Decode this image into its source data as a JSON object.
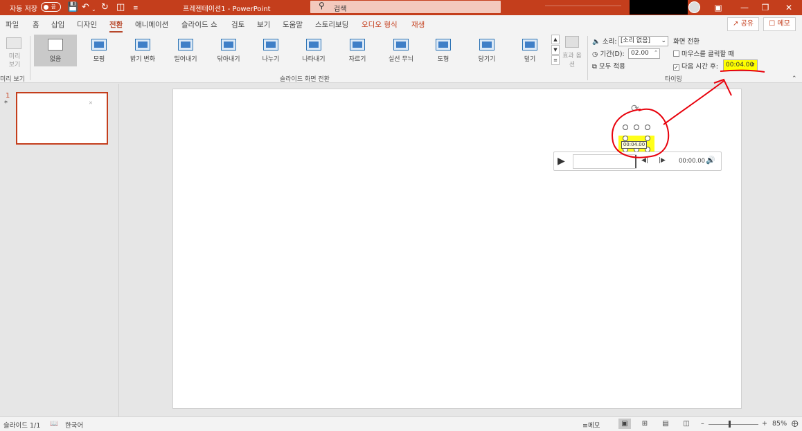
{
  "titlebar": {
    "autosave_label": "자동 저장",
    "autosave_state": "끔",
    "document_title": "프레젠테이션1  -  PowerPoint",
    "search_placeholder": "검색"
  },
  "menu": {
    "tabs": [
      "파일",
      "홈",
      "삽입",
      "디자인",
      "전환",
      "애니메이션",
      "슬라이드 쇼",
      "검토",
      "보기",
      "도움말",
      "스토리보딩",
      "오디오 형식",
      "재생"
    ],
    "active_tab": "전환",
    "share_label": "공유",
    "memo_label": "메모"
  },
  "ribbon": {
    "preview_label": "미리 보기",
    "preview_group_label": "미리 보기",
    "transitions": [
      "없음",
      "모핑",
      "밝기 변화",
      "밀어내기",
      "닦아내기",
      "나누기",
      "나타내기",
      "자르기",
      "실선 무늬",
      "도형",
      "당기기",
      "덮기"
    ],
    "selected_transition": "없음",
    "effect_options_label": "효과 옵션",
    "transitions_group_label": "슬라이드 화면 전환",
    "sound_label": "소리:",
    "sound_value": "[소리 없음]",
    "duration_label": "기간(D):",
    "duration_value": "02.00",
    "apply_all_label": "모두 적용",
    "advance_label": "화면 전환",
    "on_click_label": "마우스를 클릭할 때",
    "on_click_checked": false,
    "after_label": "다음 시간 후:",
    "after_checked": true,
    "after_value": "00:04.00",
    "timing_group_label": "타이밍"
  },
  "slides_panel": {
    "slide_number": "1",
    "slide_marker": "*"
  },
  "audio_player": {
    "time": "00:00.00",
    "trigger_tag": "00:04.00"
  },
  "statusbar": {
    "slide_info": "슬라이드 1/1",
    "language": "한국어",
    "notes_label": "메모",
    "zoom_percent": "85%"
  },
  "colors": {
    "brand": "#c43e1c",
    "highlight": "#ffff00",
    "annotation": "#e8000b"
  }
}
